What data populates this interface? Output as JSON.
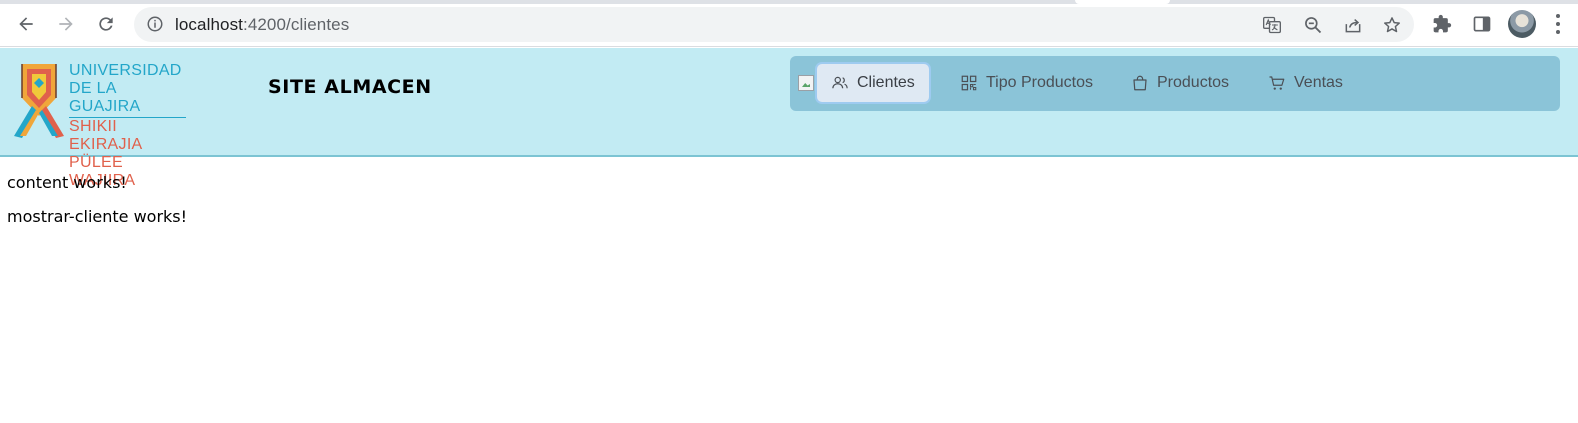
{
  "browser": {
    "url_host": "localhost",
    "url_path": ":4200/clientes",
    "icons": [
      "back-arrow-icon",
      "forward-arrow-icon",
      "reload-icon",
      "site-info-icon",
      "translate-icon",
      "zoom-out-icon",
      "share-icon",
      "bookmark-star-icon",
      "extensions-puzzle-icon",
      "side-panel-icon",
      "profile-avatar",
      "more-menu-icon"
    ]
  },
  "site": {
    "logo": {
      "line1": "UNIVERSIDAD",
      "line2": "DE LA GUAJIRA",
      "line3": "SHIKII EKIRAJIA",
      "line4": "PÜLEE WAJIIRA"
    },
    "title": "SITE ALMACEN",
    "menu": [
      {
        "label": "Clientes",
        "icon": "users-icon",
        "active": true
      },
      {
        "label": "Tipo Productos",
        "icon": "qr-grid-icon",
        "active": false
      },
      {
        "label": "Productos",
        "icon": "shopping-bag-icon",
        "active": false
      },
      {
        "label": "Ventas",
        "icon": "cart-icon",
        "active": false
      }
    ]
  },
  "content": {
    "line1": "content works!",
    "line2": "mostrar-cliente works!"
  },
  "colors": {
    "header_bg": "#c2ebf3",
    "menubar_bg": "#8bc4d8",
    "logo_blue": "#23a6c9",
    "logo_red": "#e0614c"
  }
}
